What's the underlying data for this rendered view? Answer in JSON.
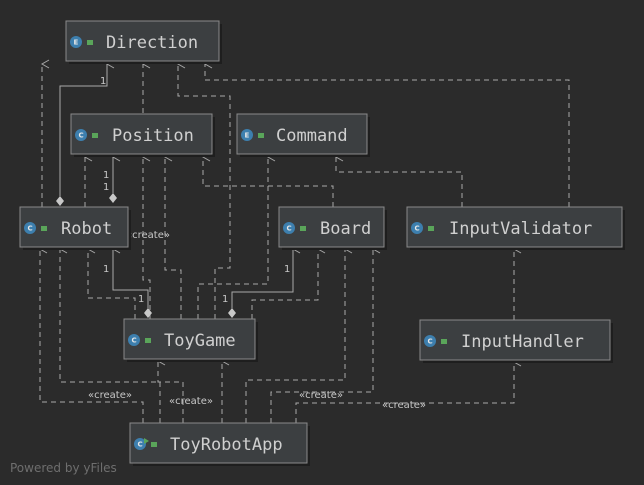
{
  "diagram": {
    "classes": {
      "direction": {
        "name": "Direction",
        "kind": "E",
        "icon": "enum-icon"
      },
      "position": {
        "name": "Position",
        "kind": "C",
        "icon": "class-icon"
      },
      "command": {
        "name": "Command",
        "kind": "E",
        "icon": "enum-icon"
      },
      "robot": {
        "name": "Robot",
        "kind": "C",
        "icon": "class-icon"
      },
      "board": {
        "name": "Board",
        "kind": "C",
        "icon": "class-icon"
      },
      "input_validator": {
        "name": "InputValidator",
        "kind": "C",
        "icon": "class-icon"
      },
      "toy_game": {
        "name": "ToyGame",
        "kind": "C",
        "icon": "class-icon"
      },
      "input_handler": {
        "name": "InputHandler",
        "kind": "C",
        "icon": "class-icon"
      },
      "toy_robot_app": {
        "name": "ToyRobotApp",
        "kind": "C",
        "icon": "main-class-icon"
      }
    },
    "labels": {
      "one": "1",
      "create": "«create»"
    }
  },
  "watermark": "Powered by yFiles",
  "colors": {
    "background": "#2b2b2b",
    "node_fill": "#3c3f41",
    "node_border": "#8a8a8a",
    "edge": "#a8a8a8",
    "badge": "#3d7fae",
    "lock": "#5aa55a"
  }
}
